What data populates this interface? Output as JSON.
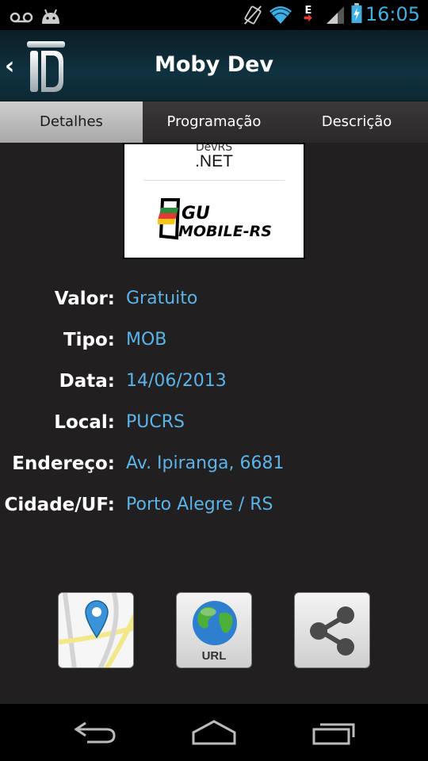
{
  "status_bar": {
    "time": "16:05",
    "icons": [
      "voicemail-icon",
      "android-icon",
      "vibrate-icon",
      "wifi-icon",
      "data-icon",
      "signal-icon",
      "battery-charging-icon"
    ]
  },
  "action_bar": {
    "title": "Moby Dev",
    "back_glyph": "‹"
  },
  "tabs": [
    {
      "label": "Detalhes",
      "active": true
    },
    {
      "label": "Programação",
      "active": false
    },
    {
      "label": "Descrição",
      "active": false
    }
  ],
  "sponsor": {
    "top_small_text": "DevRS",
    "top_text": ".NET",
    "logo_text_1": "GU",
    "logo_text_2": "MOBILE-RS"
  },
  "details": [
    {
      "label": "Valor:",
      "value": "Gratuito"
    },
    {
      "label": "Tipo:",
      "value": "MOB"
    },
    {
      "label": "Data:",
      "value": "14/06/2013"
    },
    {
      "label": "Local:",
      "value": "PUCRS"
    },
    {
      "label": "Endereço:",
      "value": "Av. Ipiranga, 6681"
    },
    {
      "label": "Cidade/UF:",
      "value": "Porto Alegre / RS"
    }
  ],
  "actions": {
    "map_icon": "map-pin-icon",
    "url_label": "URL",
    "share_icon": "share-icon"
  },
  "colors": {
    "accent": "#5ab4ea",
    "clock": "#3fb0e6",
    "background": "#221f20"
  }
}
